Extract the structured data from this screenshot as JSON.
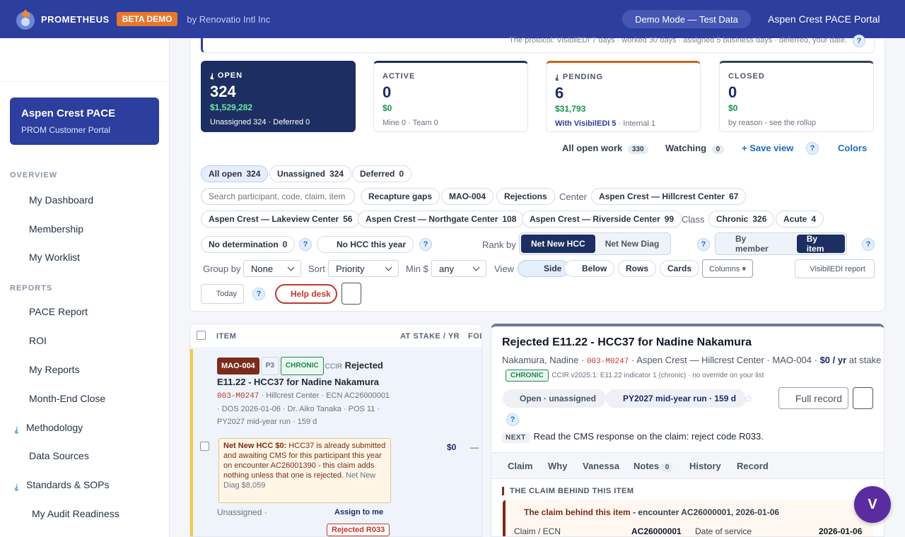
{
  "header": {
    "brand": "PROMETHEUS",
    "beta": "BETA DEMO",
    "by": "by Renovatio Intl Inc",
    "demo_mode": "Demo Mode — Test Data",
    "portal": "Aspen Crest PACE Portal"
  },
  "sidebar": {
    "org_name": "Aspen Crest PACE",
    "org_sub": "PROM Customer Portal",
    "overview_label": "OVERVIEW",
    "overview_items": [
      "My Dashboard",
      "Membership",
      "My Worklist"
    ],
    "reports_label": "REPORTS",
    "reports_items": [
      "PACE Report",
      "ROI",
      "My Reports",
      "Month-End Close",
      "Methodology",
      "Data Sources",
      "Standards & SOPs",
      "My Audit Readiness"
    ]
  },
  "protocol": "The protocol: VisibilEDI 7 days · worked 30 days · assigned 5 business days · deferred, your date.",
  "kpis": [
    {
      "label": "OPEN",
      "icon": "⸘",
      "count": "324",
      "amount": "$1,529,282",
      "sub": "Unassigned 324 · Deferred 0"
    },
    {
      "label": "ACTIVE",
      "count": "0",
      "amount": "$0",
      "sub": "Mine 0 · Team 0"
    },
    {
      "label": "PENDING",
      "icon": "⸘",
      "count": "6",
      "amount": "$31,793",
      "sub_strong": "With VisibilEDI 5",
      "sub": " · Internal 1"
    },
    {
      "label": "CLOSED",
      "count": "0",
      "amount": "$0",
      "sub": "by reason - see the rollup"
    }
  ],
  "views": {
    "all_open": "All open work",
    "all_open_count": "330",
    "watching": "Watching",
    "watching_count": "0",
    "save_view": "+ Save view",
    "colors": "Colors"
  },
  "filters": {
    "all_open": "All open",
    "all_open_count": "324",
    "unassigned": "Unassigned",
    "unassigned_count": "324",
    "deferred": "Deferred",
    "deferred_count": "0",
    "search_placeholder": "Search participant, code, claim, item",
    "recapture": "Recapture gaps",
    "mao": "MAO-004",
    "rejections": "Rejections",
    "center_label": "Center",
    "centers": [
      {
        "name": "Aspen Crest — Hillcrest Center",
        "count": "67"
      },
      {
        "name": "Aspen Crest — Lakeview Center",
        "count": "56"
      },
      {
        "name": "Aspen Crest — Northgate Center",
        "count": "108"
      },
      {
        "name": "Aspen Crest — Riverside Center",
        "count": "99"
      }
    ],
    "class_label": "Class",
    "chronic": "Chronic",
    "chronic_count": "326",
    "acute": "Acute",
    "acute_count": "4",
    "no_det": "No determination",
    "no_det_count": "0",
    "no_hcc": "No HCC this year",
    "rank_by": "Rank by",
    "rank_a": "Net New HCC",
    "rank_b": "Net New Diag",
    "by_member": "By member",
    "by_item": "By item",
    "group_by": "Group by",
    "group_val": "None",
    "sort": "Sort",
    "sort_val": "Priority",
    "min": "Min $",
    "min_val": "any",
    "view": "View",
    "view_side": "Side",
    "view_below": "Below",
    "view_rows": "Rows",
    "view_cards": "Cards",
    "columns": "Columns ▾",
    "visibil_report": "VisibilEDI report",
    "today": "Today",
    "help": "Help desk"
  },
  "list": {
    "col_item": "ITEM",
    "col_stake": "AT STAKE / YR",
    "col_fol": "FOL",
    "row": {
      "tag_mao": "MAO-004",
      "tag_p": "P3",
      "tag_chronic": "CHRONIC",
      "tag_ccir": "CCIR",
      "title_a": "Rejected",
      "title_b": "E11.22 - HCC37 for Nadine Nakamura",
      "mbi": "003-M0247",
      "meta": " · Hillcrest Center · ECN AC26000001 · DOS 2026-01-06 · Dr. Aiko Tanaka · POS 11 · PY2027 mid-year run · 159 d",
      "note_strong": "Net New HCC $0:",
      "note": " HCC37 is already submitted and awaiting CMS for this participant this year on encounter AC26001390 - this claim adds nothing unless that one is rejected.",
      "note_grey": " Net New Diag $8,059",
      "stake": "$0",
      "dash": "—",
      "unassigned": "Unassigned ·",
      "assign": "Assign to me",
      "rejected": "Rejected R033"
    }
  },
  "detail": {
    "title": "Rejected E11.22 - HCC37 for Nadine Nakamura",
    "name": "Nakamura, Nadine · ",
    "mbi": "003-M0247",
    "meta": " · Aspen Crest — Hillcrest Center · MAO-004 · ",
    "stake": "$0 / yr",
    "stake_tail": " at stake ·",
    "chronic": "CHRONIC",
    "ccir": "CCIR v2025.1: E11.22 indicator 1 (chronic) · no override on your list",
    "status": "Open · unassigned",
    "run": "PY2027 mid-year run · 159 d",
    "full_record": "Full record",
    "next_label": "NEXT",
    "next": "Read the CMS response on the claim: reject code R033.",
    "tabs": [
      "Claim",
      "Why",
      "Vanessa",
      "Notes",
      "History",
      "Record"
    ],
    "notes_count": "0",
    "section": "THE CLAIM BEHIND THIS ITEM",
    "claim_title": "The claim behind this item",
    "claim_tail": " - encounter AC26000001, 2026-01-06",
    "k1": "Claim / ECN",
    "v1": "AC26000001",
    "k2": "Date of service",
    "v2": "2026-01-06"
  },
  "avatar": "V"
}
